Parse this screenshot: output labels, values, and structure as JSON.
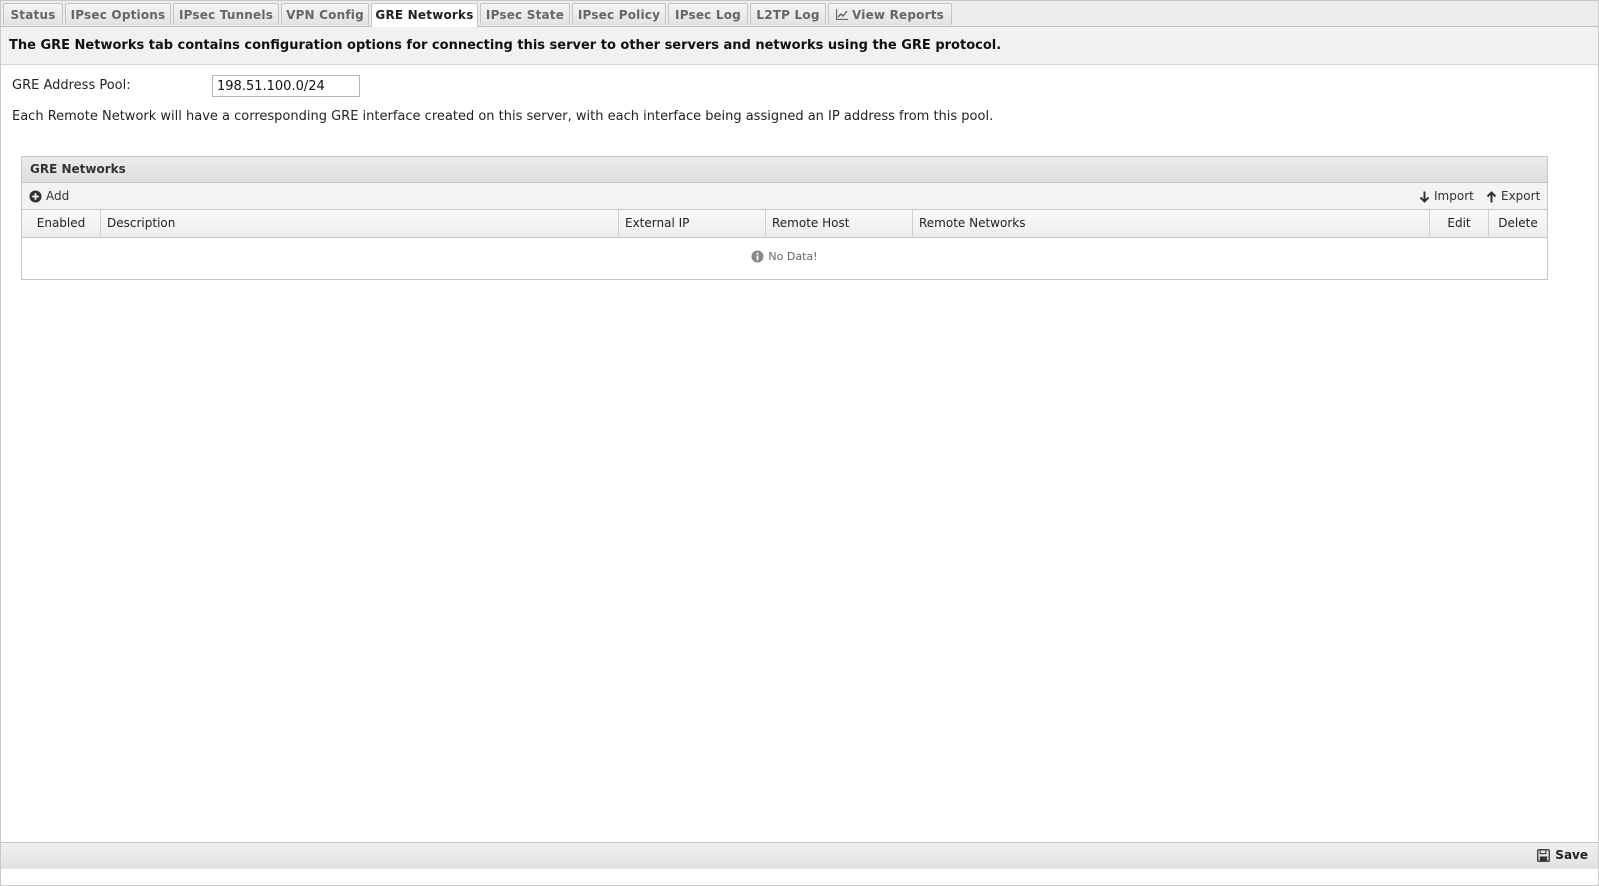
{
  "tabs": [
    {
      "label": "Status"
    },
    {
      "label": "IPsec Options"
    },
    {
      "label": "IPsec Tunnels"
    },
    {
      "label": "VPN Config"
    },
    {
      "label": "GRE Networks",
      "active": true
    },
    {
      "label": "IPsec State"
    },
    {
      "label": "IPsec Policy"
    },
    {
      "label": "IPsec Log"
    },
    {
      "label": "L2TP Log"
    },
    {
      "label": "View Reports",
      "icon": "line-chart-icon"
    }
  ],
  "description": "The GRE Networks tab contains configuration options for connecting this server to other servers and networks using the GRE protocol.",
  "address_pool": {
    "label": "GRE Address Pool:",
    "value": "198.51.100.0/24"
  },
  "help_text": "Each Remote Network will have a corresponding GRE interface created on this server, with each interface being assigned an IP address from this pool.",
  "grid": {
    "title": "GRE Networks",
    "toolbar": {
      "add": "Add",
      "import": "Import",
      "export": "Export"
    },
    "columns": [
      "Enabled",
      "Description",
      "External IP",
      "Remote Host",
      "Remote Networks",
      "Edit",
      "Delete"
    ],
    "empty_text": "No Data!"
  },
  "footer": {
    "save": "Save"
  }
}
